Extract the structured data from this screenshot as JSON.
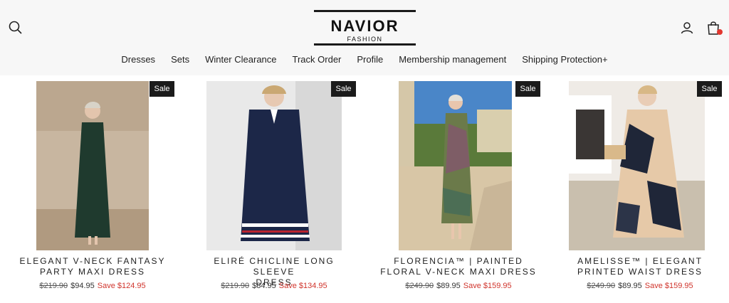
{
  "brand": {
    "name": "NAVIOR",
    "tagline": "FASHION"
  },
  "nav": [
    "Dresses",
    "Sets",
    "Winter Clearance",
    "Track Order",
    "Profile",
    "Membership management",
    "Shipping Protection+"
  ],
  "colors": {
    "header_bg": "#f7f7f7",
    "sale_badge": "#1b1b1b",
    "save_text": "#d0342c",
    "cart_dot": "#e2372f"
  },
  "icons": {
    "search": "search-icon",
    "account": "user-icon",
    "cart": "shopping-bag-icon"
  },
  "products": [
    {
      "badge": "Sale",
      "title_line1": "ELEGANT V-NECK FANTASY",
      "title_line2": "PARTY MAXI DRESS",
      "old_price": "$219.90",
      "price": "$94.95",
      "save": "Save $124.95"
    },
    {
      "badge": "Sale",
      "title_line1": "ELIRÉ CHICLINE LONG SLEEVE",
      "title_line2": "DRESS",
      "old_price": "$219.90",
      "price": "$84.95",
      "save": "Save $134.95"
    },
    {
      "badge": "Sale",
      "title_line1": "FLORENCIA™ | PAINTED",
      "title_line2": "FLORAL V-NECK MAXI DRESS",
      "old_price": "$249.90",
      "price": "$89.95",
      "save": "Save $159.95"
    },
    {
      "badge": "Sale",
      "title_line1": "AMELISSE™ | ELEGANT",
      "title_line2": "PRINTED WAIST DRESS",
      "old_price": "$249.90",
      "price": "$89.95",
      "save": "Save $159.95"
    }
  ]
}
